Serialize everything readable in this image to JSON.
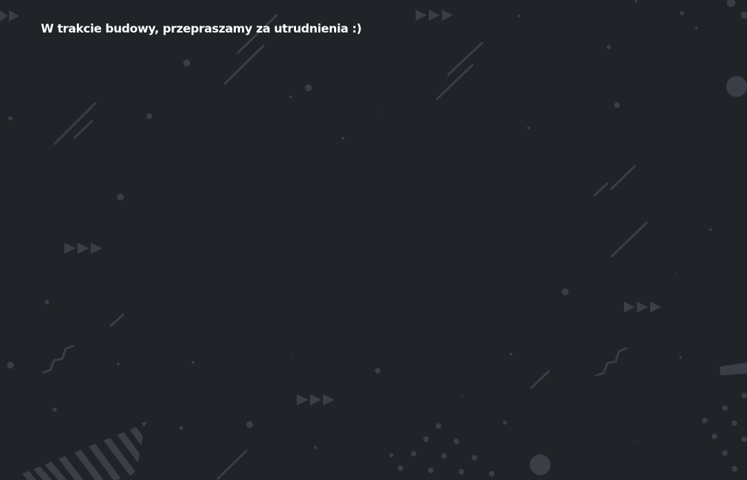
{
  "notice": {
    "message": "W trakcie budowy, przepraszamy za utrudnienia :)"
  },
  "theme": {
    "background": "#202428",
    "shape_color": "#3a3e46",
    "text_color": "#ffffff"
  }
}
